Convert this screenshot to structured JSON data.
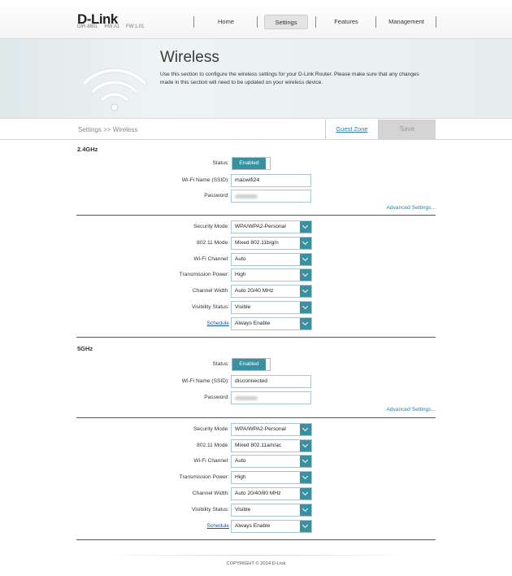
{
  "brand": {
    "logo": "D-Link",
    "model": "DIR-880L",
    "hw": "HW:A1",
    "fw": "FW:1.01"
  },
  "nav": {
    "home": "Home",
    "settings": "Settings",
    "features": "Features",
    "management": "Management"
  },
  "banner": {
    "title": "Wireless",
    "description": "Use this section to configure the wireless settings for your D-Link Router. Please make sure that any changes made in this section will need to be updated on your wireless device."
  },
  "breadcrumb": "Settings >> Wireless",
  "guest_zone": "Guest Zone",
  "save": "Save",
  "band24": {
    "title": "2.4GHz",
    "status_label": "Status:",
    "status_value": "Enabled",
    "ssid_label": "Wi-Fi Name (SSID):",
    "ssid_value": "macwifi24",
    "password_label": "Password:",
    "advanced": "Advanced Settings...",
    "security_label": "Security Mode:",
    "security_value": "WPA/WPA2-Personal",
    "mode_label": "802.11 Mode:",
    "mode_value": "Mixed 802.11b/g/n",
    "channel_label": "Wi-Fi Channel:",
    "channel_value": "Auto",
    "power_label": "Transmission Power:",
    "power_value": "High",
    "width_label": "Channel Width:",
    "width_value": "Auto 20/40 MHz",
    "visibility_label": "Visibility Status:",
    "visibility_value": "Visible",
    "schedule_label": "Schedule",
    "schedule_value": "Always Enable"
  },
  "band5": {
    "title": "5GHz",
    "status_label": "Status:",
    "status_value": "Enabled",
    "ssid_label": "Wi-Fi Name (SSID):",
    "ssid_value": "disconnected",
    "password_label": "Password:",
    "advanced": "Advanced Settings...",
    "security_label": "Security Mode:",
    "security_value": "WPA/WPA2-Personal",
    "mode_label": "802.11 Mode:",
    "mode_value": "Mixed 802.11a/n/ac",
    "channel_label": "Wi-Fi Channel:",
    "channel_value": "Auto",
    "power_label": "Transmission Power:",
    "power_value": "High",
    "width_label": "Channel Width:",
    "width_value": "Auto 20/40/80 MHz",
    "visibility_label": "Visibility Status:",
    "visibility_value": "Visible",
    "schedule_label": "Schedule",
    "schedule_value": "Always Enable"
  },
  "footer": {
    "copyright": "COPYRIGHT © 2014 D-Link"
  },
  "colors": {
    "accent": "#3990a1",
    "link": "#2b7fa5",
    "schedule_link": "#1c55a8"
  }
}
